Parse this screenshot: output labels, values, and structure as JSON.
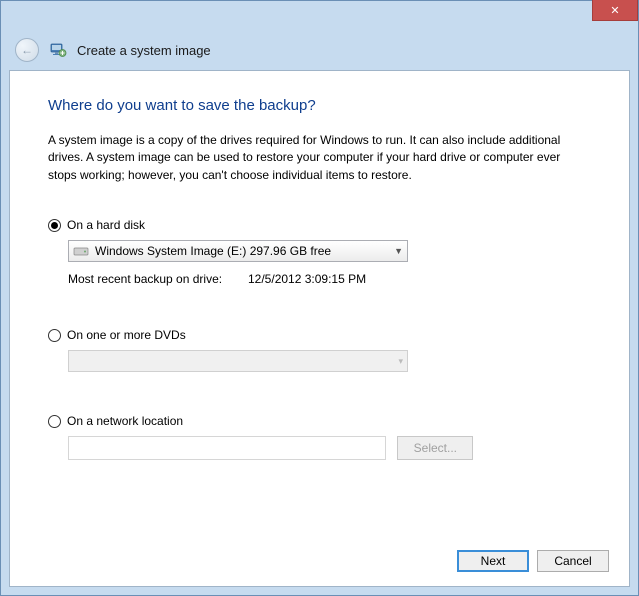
{
  "titlebar": {
    "close_glyph": "✕"
  },
  "header": {
    "back_glyph": "←",
    "title": "Create a system image"
  },
  "main": {
    "heading": "Where do you want to save the backup?",
    "description": "A system image is a copy of the drives required for Windows to run. It can also include additional drives. A system image can be used to restore your computer if your hard drive or computer ever stops working; however, you can't choose individual items to restore."
  },
  "options": {
    "hard_disk": {
      "label": "On a hard disk",
      "checked": true,
      "selected_drive": "Windows System Image (E:)  297.96 GB free",
      "info_label": "Most recent backup on drive:",
      "info_value": "12/5/2012 3:09:15 PM"
    },
    "dvd": {
      "label": "On one or more DVDs",
      "checked": false
    },
    "network": {
      "label": "On a network location",
      "checked": false,
      "select_button": "Select..."
    }
  },
  "buttons": {
    "next": "Next",
    "cancel": "Cancel"
  }
}
